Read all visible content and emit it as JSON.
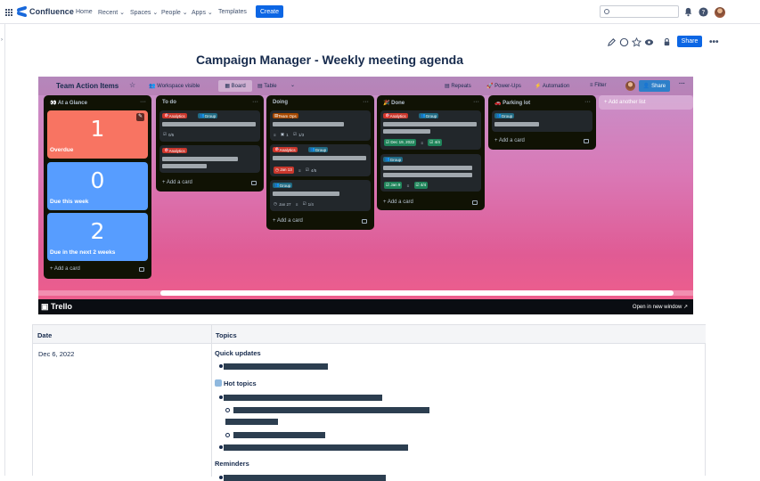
{
  "app": {
    "name": "Confluence"
  },
  "nav": {
    "home": "Home",
    "recent": "Recent",
    "spaces": "Spaces",
    "people": "People",
    "apps": "Apps",
    "templates": "Templates",
    "create": "Create"
  },
  "page": {
    "title": "Campaign Manager - Weekly meeting agenda",
    "share": "Share"
  },
  "trello": {
    "board_title": "Team Action Items",
    "visibility": "Workspace visible",
    "view_board": "Board",
    "view_table": "Table",
    "repeats": "Repeats",
    "power_ups": "Power-Ups",
    "automation": "Automation",
    "filter": "Filter",
    "share": "Share",
    "add_list": "Add another list",
    "open_new_window": "Open in new window",
    "footer_logo": "Trello",
    "add_card": "Add a card",
    "lists": [
      {
        "title": "At a Glance",
        "glance": [
          {
            "number": "1",
            "caption": "Overdue",
            "color": "#f87462"
          },
          {
            "number": "0",
            "caption": "Due this week",
            "color": "#579dff"
          },
          {
            "number": "2",
            "caption": "Due in the next 2 weeks",
            "color": "#579dff"
          }
        ]
      },
      {
        "title": "To do",
        "cards": [
          {
            "labels": [
              "Analytics",
              "Group"
            ],
            "checklist": "0/5"
          },
          {
            "labels": [
              "Analytics"
            ]
          }
        ]
      },
      {
        "title": "Doing",
        "cards": [
          {
            "labels": [
              "Team Ops"
            ],
            "count": "1",
            "checklist": "1/3"
          },
          {
            "labels": [
              "Analytics",
              "Group"
            ],
            "due": "Jan 13",
            "checklist": "4/5"
          },
          {
            "labels": [
              "Group"
            ],
            "due": "Jan 27",
            "checklist": "1/4"
          }
        ]
      },
      {
        "title": "Done",
        "cards": [
          {
            "labels": [
              "Analytics",
              "Group"
            ],
            "due": "Dec 19, 2022",
            "checklist": "4/4"
          },
          {
            "labels": [
              "Group"
            ],
            "due": "Jan 9",
            "checklist": "4/4"
          }
        ]
      },
      {
        "title": "Parking lot",
        "cards": [
          {
            "labels": [
              "Group"
            ]
          }
        ]
      }
    ]
  },
  "agenda": {
    "col_date": "Date",
    "col_topics": "Topics",
    "date": "Dec 6, 2022",
    "quick_updates": "Quick updates",
    "hot_topics": "Hot topics",
    "reminders": "Reminders"
  },
  "colors": {
    "accent": "#0c66e4",
    "overdue": "#f87462",
    "due": "#579dff",
    "label_red": "#c9372c",
    "label_teal": "#206a83",
    "label_orange": "#a54800",
    "label_green": "#216e4e"
  }
}
